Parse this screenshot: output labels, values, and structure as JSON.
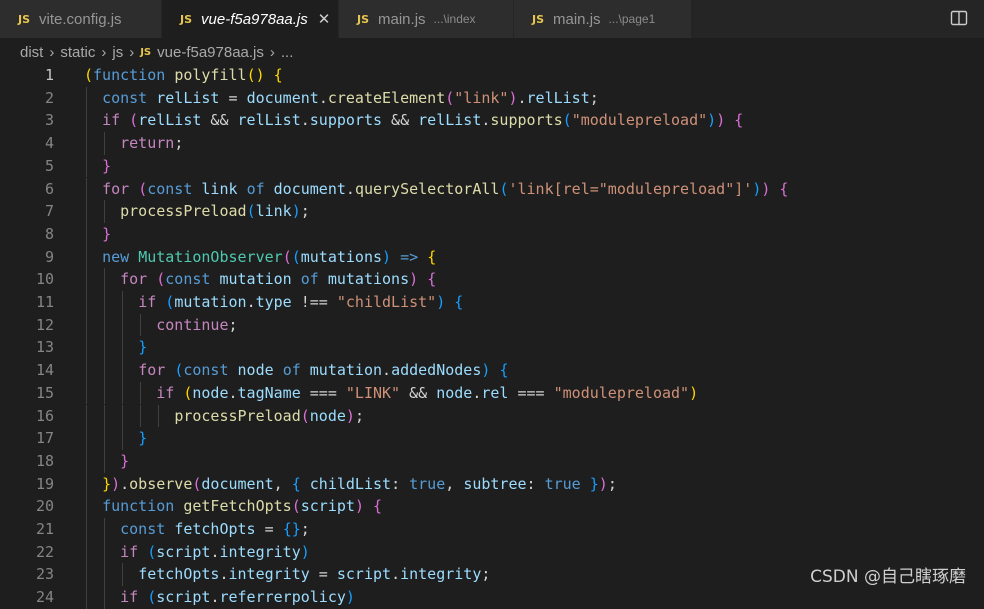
{
  "tabs": [
    {
      "label": "vite.config.js",
      "path": "",
      "active": false,
      "italic": false
    },
    {
      "label": "vue-f5a978aa.js",
      "path": "",
      "active": true,
      "italic": true,
      "close": "✕"
    },
    {
      "label": "main.js",
      "path": "...\\index",
      "active": false,
      "italic": false
    },
    {
      "label": "main.js",
      "path": "...\\page1",
      "active": false,
      "italic": false
    }
  ],
  "tab_icon_text": "JS",
  "breadcrumb": [
    "dist",
    "static",
    "js",
    "vue-f5a978aa.js",
    "..."
  ],
  "current_line": 1,
  "lines": [
    [
      [
        "(",
        "b1"
      ],
      [
        "function",
        "kw"
      ],
      [
        " ",
        ""
      ],
      [
        "polyfill",
        "fn"
      ],
      [
        "() {",
        "b1"
      ]
    ],
    [
      [
        "  ",
        ""
      ],
      [
        "const",
        "kw"
      ],
      [
        " ",
        ""
      ],
      [
        "relList",
        "vr"
      ],
      [
        " = ",
        ""
      ],
      [
        "document",
        "vr"
      ],
      [
        ".",
        ""
      ],
      [
        "createElement",
        "fn"
      ],
      [
        "(",
        "b2"
      ],
      [
        "\"link\"",
        "st"
      ],
      [
        ")",
        "b2"
      ],
      [
        ".",
        ""
      ],
      [
        "relList",
        "vr"
      ],
      [
        ";",
        ""
      ]
    ],
    [
      [
        "  ",
        ""
      ],
      [
        "if",
        "kw2"
      ],
      [
        " ",
        ""
      ],
      [
        "(",
        "b2"
      ],
      [
        "relList",
        "vr"
      ],
      [
        " && ",
        ""
      ],
      [
        "relList",
        "vr"
      ],
      [
        ".",
        ""
      ],
      [
        "supports",
        "vr"
      ],
      [
        " && ",
        ""
      ],
      [
        "relList",
        "vr"
      ],
      [
        ".",
        ""
      ],
      [
        "supports",
        "fn"
      ],
      [
        "(",
        "b3"
      ],
      [
        "\"modulepreload\"",
        "st"
      ],
      [
        ")",
        "b3"
      ],
      [
        ")",
        "b2"
      ],
      [
        " ",
        ""
      ],
      [
        "{",
        "b2"
      ]
    ],
    [
      [
        "    ",
        ""
      ],
      [
        "return",
        "kw2"
      ],
      [
        ";",
        ""
      ]
    ],
    [
      [
        "  ",
        ""
      ],
      [
        "}",
        "b2"
      ]
    ],
    [
      [
        "  ",
        ""
      ],
      [
        "for",
        "kw2"
      ],
      [
        " ",
        ""
      ],
      [
        "(",
        "b2"
      ],
      [
        "const",
        "kw"
      ],
      [
        " ",
        ""
      ],
      [
        "link",
        "vr"
      ],
      [
        " ",
        ""
      ],
      [
        "of",
        "kw"
      ],
      [
        " ",
        ""
      ],
      [
        "document",
        "vr"
      ],
      [
        ".",
        ""
      ],
      [
        "querySelectorAll",
        "fn"
      ],
      [
        "(",
        "b3"
      ],
      [
        "'link[rel=\"modulepreload\"]'",
        "st"
      ],
      [
        ")",
        "b3"
      ],
      [
        ")",
        "b2"
      ],
      [
        " ",
        ""
      ],
      [
        "{",
        "b2"
      ]
    ],
    [
      [
        "    ",
        ""
      ],
      [
        "processPreload",
        "fn"
      ],
      [
        "(",
        "b3"
      ],
      [
        "link",
        "vr"
      ],
      [
        ")",
        "b3"
      ],
      [
        ";",
        ""
      ]
    ],
    [
      [
        "  ",
        ""
      ],
      [
        "}",
        "b2"
      ]
    ],
    [
      [
        "  ",
        ""
      ],
      [
        "new",
        "kw"
      ],
      [
        " ",
        ""
      ],
      [
        "MutationObserver",
        "cl"
      ],
      [
        "(",
        "b2"
      ],
      [
        "(",
        "b3"
      ],
      [
        "mutations",
        "vr"
      ],
      [
        ")",
        "b3"
      ],
      [
        " ",
        ""
      ],
      [
        "=>",
        "kw"
      ],
      [
        " ",
        ""
      ],
      [
        "{",
        "b1"
      ]
    ],
    [
      [
        "    ",
        ""
      ],
      [
        "for",
        "kw2"
      ],
      [
        " ",
        ""
      ],
      [
        "(",
        "b2"
      ],
      [
        "const",
        "kw"
      ],
      [
        " ",
        ""
      ],
      [
        "mutation",
        "vr"
      ],
      [
        " ",
        ""
      ],
      [
        "of",
        "kw"
      ],
      [
        " ",
        ""
      ],
      [
        "mutations",
        "vr"
      ],
      [
        ")",
        "b2"
      ],
      [
        " ",
        ""
      ],
      [
        "{",
        "b2"
      ]
    ],
    [
      [
        "      ",
        ""
      ],
      [
        "if",
        "kw2"
      ],
      [
        " ",
        ""
      ],
      [
        "(",
        "b3"
      ],
      [
        "mutation",
        "vr"
      ],
      [
        ".",
        ""
      ],
      [
        "type",
        "vr"
      ],
      [
        " !== ",
        ""
      ],
      [
        "\"childList\"",
        "st"
      ],
      [
        ")",
        "b3"
      ],
      [
        " ",
        ""
      ],
      [
        "{",
        "b3"
      ]
    ],
    [
      [
        "        ",
        ""
      ],
      [
        "continue",
        "kw2"
      ],
      [
        ";",
        ""
      ]
    ],
    [
      [
        "      ",
        ""
      ],
      [
        "}",
        "b3"
      ]
    ],
    [
      [
        "      ",
        ""
      ],
      [
        "for",
        "kw2"
      ],
      [
        " ",
        ""
      ],
      [
        "(",
        "b3"
      ],
      [
        "const",
        "kw"
      ],
      [
        " ",
        ""
      ],
      [
        "node",
        "vr"
      ],
      [
        " ",
        ""
      ],
      [
        "of",
        "kw"
      ],
      [
        " ",
        ""
      ],
      [
        "mutation",
        "vr"
      ],
      [
        ".",
        ""
      ],
      [
        "addedNodes",
        "vr"
      ],
      [
        ")",
        "b3"
      ],
      [
        " ",
        ""
      ],
      [
        "{",
        "b3"
      ]
    ],
    [
      [
        "        ",
        ""
      ],
      [
        "if",
        "kw2"
      ],
      [
        " ",
        ""
      ],
      [
        "(",
        "b1"
      ],
      [
        "node",
        "vr"
      ],
      [
        ".",
        ""
      ],
      [
        "tagName",
        "vr"
      ],
      [
        " === ",
        ""
      ],
      [
        "\"LINK\"",
        "st"
      ],
      [
        " && ",
        ""
      ],
      [
        "node",
        "vr"
      ],
      [
        ".",
        ""
      ],
      [
        "rel",
        "vr"
      ],
      [
        " === ",
        ""
      ],
      [
        "\"modulepreload\"",
        "st"
      ],
      [
        ")",
        "b1"
      ]
    ],
    [
      [
        "          ",
        ""
      ],
      [
        "processPreload",
        "fn"
      ],
      [
        "(",
        "b2"
      ],
      [
        "node",
        "vr"
      ],
      [
        ")",
        "b2"
      ],
      [
        ";",
        ""
      ]
    ],
    [
      [
        "      ",
        ""
      ],
      [
        "}",
        "b3"
      ]
    ],
    [
      [
        "    ",
        ""
      ],
      [
        "}",
        "b2"
      ]
    ],
    [
      [
        "  ",
        ""
      ],
      [
        "}",
        "b1"
      ],
      [
        ")",
        "b2"
      ],
      [
        ".",
        ""
      ],
      [
        "observe",
        "fn"
      ],
      [
        "(",
        "b2"
      ],
      [
        "document",
        "vr"
      ],
      [
        ", ",
        ""
      ],
      [
        "{",
        "b3"
      ],
      [
        " ",
        ""
      ],
      [
        "childList",
        "vr"
      ],
      [
        ": ",
        ""
      ],
      [
        "true",
        "kw"
      ],
      [
        ", ",
        ""
      ],
      [
        "subtree",
        "vr"
      ],
      [
        ": ",
        ""
      ],
      [
        "true",
        "kw"
      ],
      [
        " ",
        ""
      ],
      [
        "}",
        "b3"
      ],
      [
        ")",
        "b2"
      ],
      [
        ";",
        ""
      ]
    ],
    [
      [
        "  ",
        ""
      ],
      [
        "function",
        "kw"
      ],
      [
        " ",
        ""
      ],
      [
        "getFetchOpts",
        "fn"
      ],
      [
        "(",
        "b2"
      ],
      [
        "script",
        "vr"
      ],
      [
        ")",
        "b2"
      ],
      [
        " ",
        ""
      ],
      [
        "{",
        "b2"
      ]
    ],
    [
      [
        "    ",
        ""
      ],
      [
        "const",
        "kw"
      ],
      [
        " ",
        ""
      ],
      [
        "fetchOpts",
        "vr"
      ],
      [
        " = ",
        ""
      ],
      [
        "{}",
        "b3"
      ],
      [
        ";",
        ""
      ]
    ],
    [
      [
        "    ",
        ""
      ],
      [
        "if",
        "kw2"
      ],
      [
        " ",
        ""
      ],
      [
        "(",
        "b3"
      ],
      [
        "script",
        "vr"
      ],
      [
        ".",
        ""
      ],
      [
        "integrity",
        "vr"
      ],
      [
        ")",
        "b3"
      ]
    ],
    [
      [
        "      ",
        ""
      ],
      [
        "fetchOpts",
        "vr"
      ],
      [
        ".",
        ""
      ],
      [
        "integrity",
        "vr"
      ],
      [
        " = ",
        ""
      ],
      [
        "script",
        "vr"
      ],
      [
        ".",
        ""
      ],
      [
        "integrity",
        "vr"
      ],
      [
        ";",
        ""
      ]
    ],
    [
      [
        "    ",
        ""
      ],
      [
        "if",
        "kw2"
      ],
      [
        " ",
        ""
      ],
      [
        "(",
        "b3"
      ],
      [
        "script",
        "vr"
      ],
      [
        ".",
        ""
      ],
      [
        "referrerpolicy",
        "vr"
      ],
      [
        ")",
        "b3"
      ]
    ]
  ],
  "watermark": "CSDN @自己瞎琢磨",
  "colors": {
    "background": "#1e1e1e",
    "tabbar": "#252526",
    "keyword": "#569cd6",
    "control": "#c586c0",
    "function": "#dcdcaa",
    "variable": "#9cdcfe",
    "string": "#ce9178",
    "class": "#4ec9b0"
  }
}
